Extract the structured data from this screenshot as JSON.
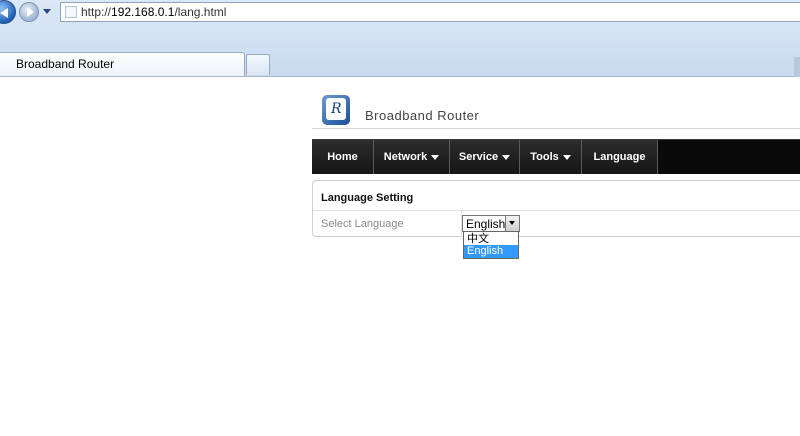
{
  "browser": {
    "url_prefix": "http://",
    "url_host": "192.168.0.1",
    "url_path": "/lang.html",
    "tab_title": "Broadband Router"
  },
  "brand": {
    "logo_letter": "R",
    "name": "Broadband Router"
  },
  "menu": {
    "items": [
      {
        "label": "Home",
        "has_arrow": false
      },
      {
        "label": "Network",
        "has_arrow": true
      },
      {
        "label": "Service",
        "has_arrow": true
      },
      {
        "label": "Tools",
        "has_arrow": true
      },
      {
        "label": "Language",
        "has_arrow": false
      }
    ]
  },
  "panel": {
    "title": "Language Setting",
    "field_label": "Select Language"
  },
  "language_select": {
    "value": "English",
    "options": [
      "中文",
      "English"
    ],
    "highlighted": "English"
  },
  "colors": {
    "menu_bg": "#0c0c0c",
    "selection": "#3399ff",
    "brand_blue": "#1b4f96"
  }
}
